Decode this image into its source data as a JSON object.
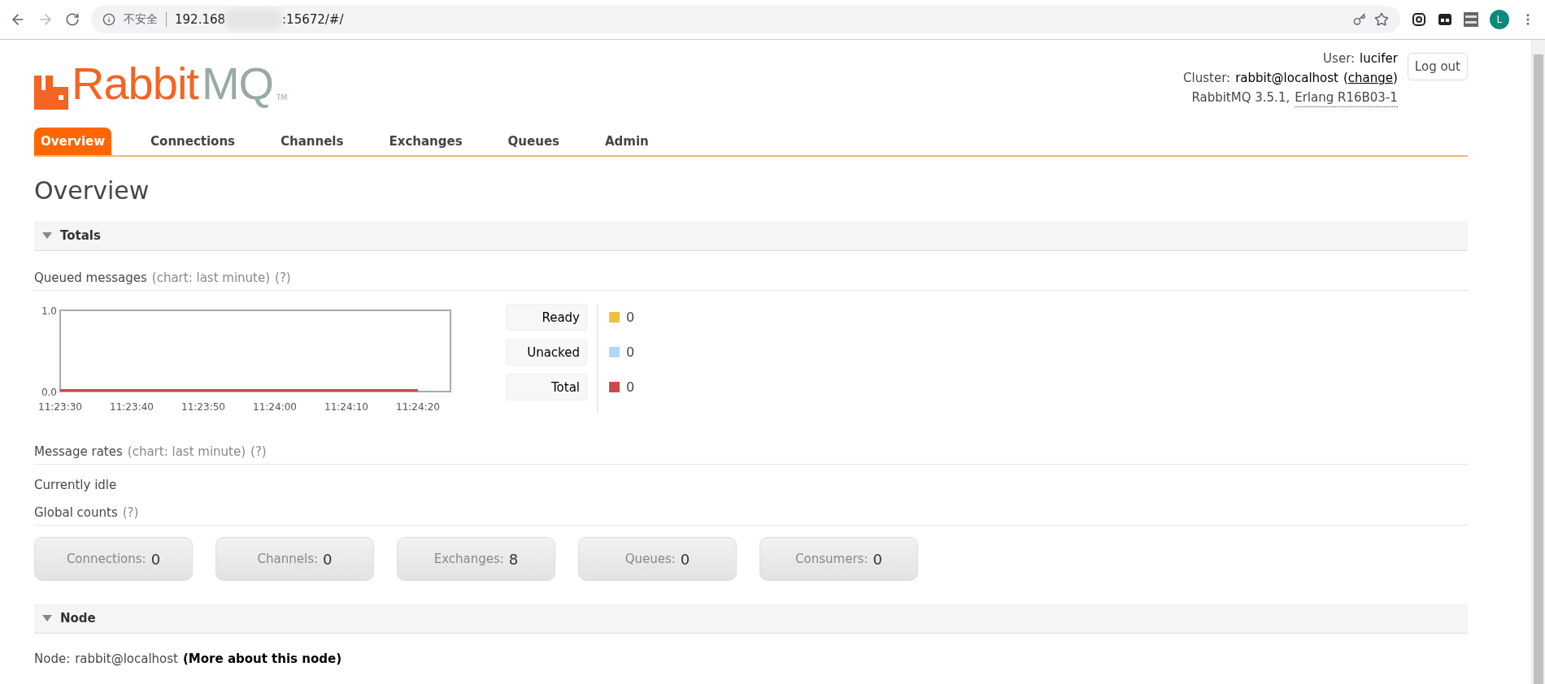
{
  "browser": {
    "security_label": "不安全",
    "url_prefix": "192.168",
    "url_suffix": ":15672/#/",
    "profile_initial": "L"
  },
  "header": {
    "logo": {
      "part_1": "Rabbit",
      "part_2": "MQ",
      "mark": "TM"
    },
    "user": {
      "label": "User:",
      "name": "lucifer"
    },
    "cluster": {
      "label": "Cluster:",
      "name": "rabbit@localhost",
      "open": "(",
      "link": "change",
      "close": ")"
    },
    "version": {
      "text": "RabbitMQ 3.5.1,",
      "erlang": "Erlang R16B03-1"
    },
    "logout": "Log out"
  },
  "tabs": [
    {
      "label": "Overview",
      "selected": true
    },
    {
      "label": "Connections",
      "selected": false
    },
    {
      "label": "Channels",
      "selected": false
    },
    {
      "label": "Exchanges",
      "selected": false
    },
    {
      "label": "Queues",
      "selected": false
    },
    {
      "label": "Admin",
      "selected": false
    }
  ],
  "page_title": "Overview",
  "totals": {
    "title": "Totals",
    "expanded": true,
    "queued": {
      "label": "Queued messages",
      "hint": "(chart: last minute)",
      "help": "(?)",
      "chart_data": {
        "type": "line",
        "categories": [
          "11:23:30",
          "11:23:40",
          "11:23:50",
          "11:24:00",
          "11:24:10",
          "11:24:20"
        ],
        "ylim": [
          0,
          1
        ],
        "yticks": [
          {
            "value": 0,
            "label": "0.0"
          },
          {
            "value": 1,
            "label": "1.0"
          }
        ],
        "series": [
          {
            "name": "Ready",
            "color": "#edc240",
            "values": [
              null,
              null,
              null,
              null,
              null,
              null
            ]
          },
          {
            "name": "Unacked",
            "color": "#afd8f8",
            "values": [
              null,
              null,
              null,
              null,
              null,
              null
            ]
          },
          {
            "name": "Total",
            "color": "#cb4b4b",
            "values": [
              0,
              0,
              0,
              0,
              0,
              0
            ]
          }
        ]
      },
      "legend_values": [
        "0",
        "0",
        "0"
      ]
    },
    "rates": {
      "label": "Message rates",
      "hint": "(chart: last minute)",
      "help": "(?)",
      "status": "Currently idle"
    },
    "global": {
      "label": "Global counts",
      "help": "(?)",
      "counts": [
        {
          "label": "Connections:",
          "value": "0"
        },
        {
          "label": "Channels:",
          "value": "0"
        },
        {
          "label": "Exchanges:",
          "value": "8"
        },
        {
          "label": "Queues:",
          "value": "0"
        },
        {
          "label": "Consumers:",
          "value": "0"
        }
      ]
    }
  },
  "node": {
    "title": "Node",
    "expanded": true,
    "label": "Node:",
    "name": "rabbit@localhost",
    "link": "(More about this node)"
  }
}
